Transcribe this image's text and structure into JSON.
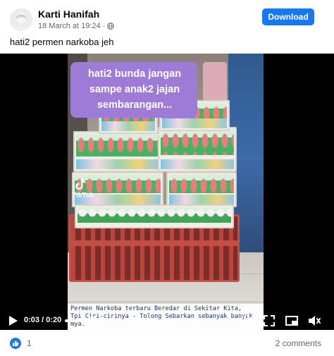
{
  "post": {
    "author": "Karti Hanifah",
    "timestamp": "18 March at 19:24",
    "audience_icon": "globe-icon",
    "caption": "hati2 permen narkoba jeh",
    "download_label": "Download"
  },
  "video": {
    "overlay_text": "hati2 bunda jangan\nsampe anak2 jajan\nsembarangan...",
    "watermark_brand": "TikTok",
    "subtitle": "Permen Narkoba terbaru Beredar di Sekitar Kita,\nTpi Ciri-cirinya - Tolong Sebarkan sebanyak banyak\nNya.",
    "time": "0:03 / 0:20",
    "progress": 0.15,
    "icons": [
      "play-icon",
      "settings-icon",
      "fullscreen-icon",
      "miniplayer-icon",
      "volume-icon"
    ]
  },
  "footer": {
    "like_count": "1",
    "comments": "2 comments"
  },
  "colors": {
    "accent": "#1877f2",
    "overlay_purple": "#9f7bd8",
    "subtitle_text": "#1f2e6a"
  }
}
